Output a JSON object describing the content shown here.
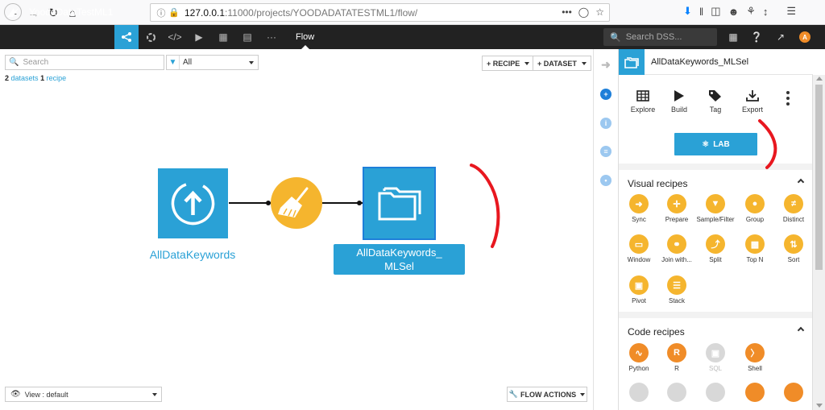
{
  "browser": {
    "url_host": "127.0.0.1",
    "url_path": ":11000/projects/YOODADATATESTML1/flow/",
    "url_more": "•••"
  },
  "app": {
    "project_title": "YoodaDataTestML1",
    "flow_label": "Flow",
    "search_placeholder": "Search DSS...",
    "avatar_initial": "A"
  },
  "canvas": {
    "search_placeholder": "Search",
    "filter_value": "All",
    "counts": {
      "datasets_num": "2",
      "datasets_label": "datasets",
      "recipes_num": "1",
      "recipes_label": "recipe"
    },
    "recipe_button": "+ RECIPE",
    "dataset_button": "+ DATASET",
    "nodes": {
      "source_label": "AllDataKeywords",
      "target_label_line1": "AllDataKeywords_",
      "target_label_line2": "MLSel"
    },
    "view_select": "View : default",
    "flow_actions": "FLOW ACTIONS"
  },
  "panel": {
    "title": "AllDataKeywords_MLSel",
    "actions": [
      "Explore",
      "Build",
      "Tag",
      "Export"
    ],
    "lab_button": "LAB",
    "visual_recipes_title": "Visual recipes",
    "visual_recipes": [
      "Sync",
      "Prepare",
      "Sample/Filter",
      "Group",
      "Distinct",
      "Window",
      "Join with...",
      "Split",
      "Top N",
      "Sort",
      "Pivot",
      "Stack"
    ],
    "code_recipes_title": "Code recipes",
    "code_recipes": [
      "Python",
      "R",
      "SQL",
      "Shell"
    ]
  },
  "colors": {
    "accent": "#2aa1d6",
    "visual_recipe": "#f5b52e",
    "code_recipe": "#f08c28",
    "annotation": "#e8171f"
  }
}
